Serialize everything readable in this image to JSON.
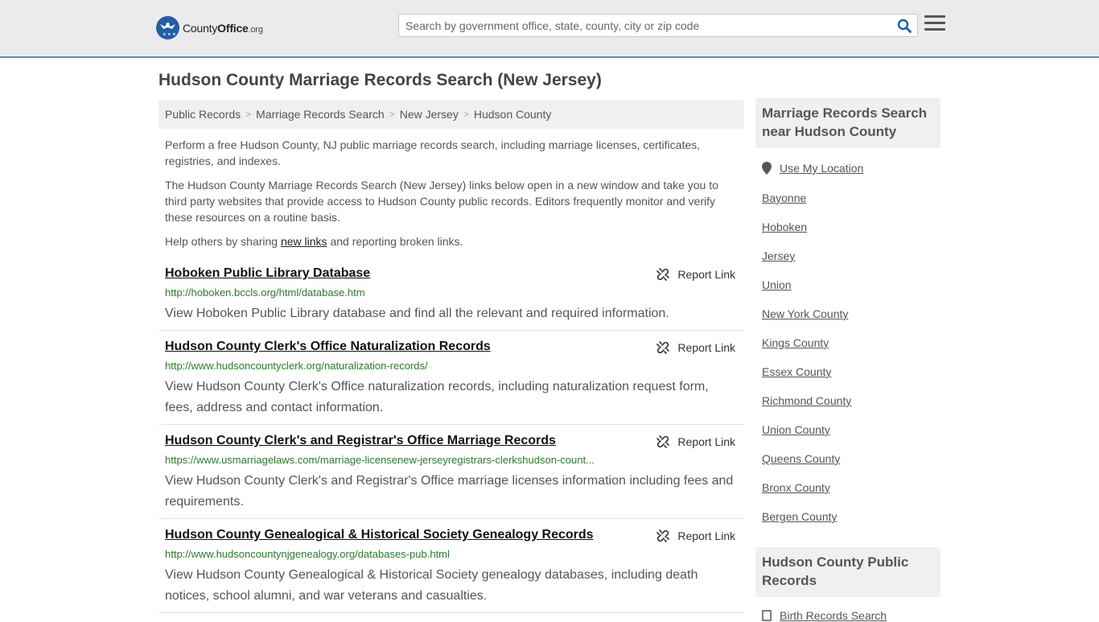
{
  "header": {
    "logo_name": "County",
    "logo_bold": "Office",
    "logo_tld": ".org",
    "search_placeholder": "Search by government office, state, county, city or zip code"
  },
  "page_title": "Hudson County Marriage Records Search (New Jersey)",
  "breadcrumb": [
    "Public Records",
    "Marriage Records Search",
    "New Jersey",
    "Hudson County"
  ],
  "intro": {
    "p1": "Perform a free Hudson County, NJ public marriage records search, including marriage licenses, certificates, registries, and indexes.",
    "p2": "The Hudson County Marriage Records Search (New Jersey) links below open in a new window and take you to third party websites that provide access to Hudson County public records. Editors frequently monitor and verify these resources on a routine basis.",
    "p3_before": "Help others by sharing ",
    "p3_link": "new links",
    "p3_after": " and reporting broken links."
  },
  "report_label": "Report Link",
  "entries": [
    {
      "title": "Hoboken Public Library Database",
      "url": "http://hoboken.bccls.org/html/database.htm",
      "desc": "View Hoboken Public Library database and find all the relevant and required information."
    },
    {
      "title": "Hudson County Clerk's Office Naturalization Records",
      "url": "http://www.hudsoncountyclerk.org/naturalization-records/",
      "desc": "View Hudson County Clerk's Office naturalization records, including naturalization request form, fees, address and contact information."
    },
    {
      "title": "Hudson County Clerk's and Registrar's Office Marriage Records",
      "url": "https://www.usmarriagelaws.com/marriage-licensenew-jerseyregistrars-clerkshudson-count...",
      "desc": "View Hudson County Clerk's and Registrar's Office marriage licenses information including fees and requirements."
    },
    {
      "title": "Hudson County Genealogical & Historical Society Genealogy Records",
      "url": "http://www.hudsoncountynjgenealogy.org/databases-pub.html",
      "desc": "View Hudson County Genealogical & Historical Society genealogy databases, including death notices, school alumni, and war veterans and casualties."
    }
  ],
  "sidebar": {
    "near_title": "Marriage Records Search near Hudson County",
    "use_location": "Use My Location",
    "near_links": [
      "Bayonne",
      "Hoboken",
      "Jersey",
      "Union",
      "New York County",
      "Kings County",
      "Essex County",
      "Richmond County",
      "Union County",
      "Queens County",
      "Bronx County",
      "Bergen County"
    ],
    "public_title": "Hudson County Public Records",
    "public_links": [
      "Birth Records Search"
    ]
  },
  "colors": {
    "accent": "#1f5fa4",
    "url_green": "#2b7a2b",
    "header_bg": "#ebebeb"
  }
}
